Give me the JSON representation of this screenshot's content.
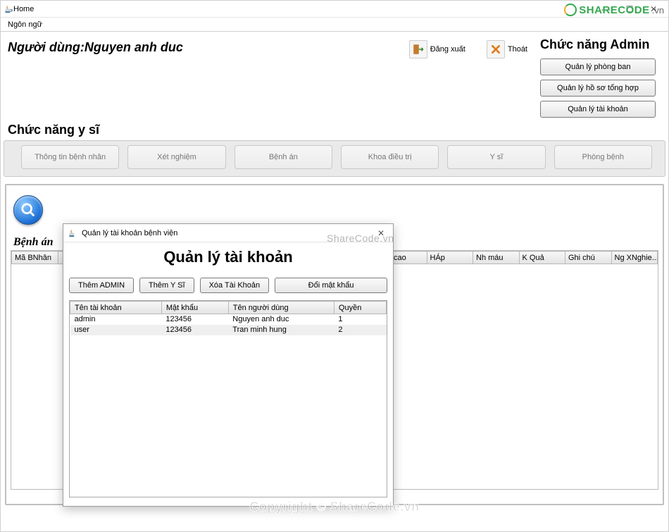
{
  "window": {
    "title": "Home",
    "minimize": "—",
    "maximize": "☐",
    "close": "✕"
  },
  "menubar": {
    "language": "Ngôn ngữ"
  },
  "user": {
    "prefix": "Người dùng:",
    "name": "Nguyen anh duc"
  },
  "toolbar": {
    "logout": "Đăng xuất",
    "exit": "Thoát"
  },
  "admin": {
    "header": "Chức năng Admin",
    "buttons": {
      "phongban": "Quản lý phòng ban",
      "hoso": "Quản lý hồ sơ tổng hợp",
      "taikhoan": "Quản lý tài khoản"
    }
  },
  "doctor": {
    "header": "Chức năng y sĩ",
    "buttons": {
      "b1": "Thông tin bệnh nhân",
      "b2": "Xét nghiệm",
      "b3": "Bệnh án",
      "b4": "Khoa điều trị",
      "b5": "Y sĩ",
      "b6": "Phòng bệnh"
    }
  },
  "benhan": {
    "title": "Bệnh án",
    "columns": [
      "Mã BNhân",
      "",
      "",
      "",
      "",
      "",
      "",
      "",
      "Chcao",
      "HÁp",
      "Nh máu",
      "K Quả",
      "Ghi chú",
      "Ng XNghie..."
    ]
  },
  "dialog": {
    "title": "Quản lý tài khoản bệnh viện",
    "heading": "Quản lý tài khoản",
    "buttons": {
      "addAdmin": "Thêm ADMIN",
      "addYs": "Thêm Y Sĩ",
      "delete": "Xóa Tài Khoản",
      "changePw": "Đổi mật khẩu"
    },
    "columns": {
      "user": "Tên tài khoản",
      "pass": "Mật khẩu",
      "name": "Tên người dùng",
      "role": "Quyền"
    },
    "rows": [
      {
        "user": "admin",
        "pass": "123456",
        "name": "Nguyen anh duc",
        "role": "1"
      },
      {
        "user": "user",
        "pass": "123456",
        "name": "Tran minh hung",
        "role": "2"
      }
    ]
  },
  "watermark": {
    "small": "ShareCode.vn",
    "copyright": "Copyright © ShareCode.vn",
    "logo_brand": "SHARECODE",
    "logo_ext": ".vn"
  }
}
